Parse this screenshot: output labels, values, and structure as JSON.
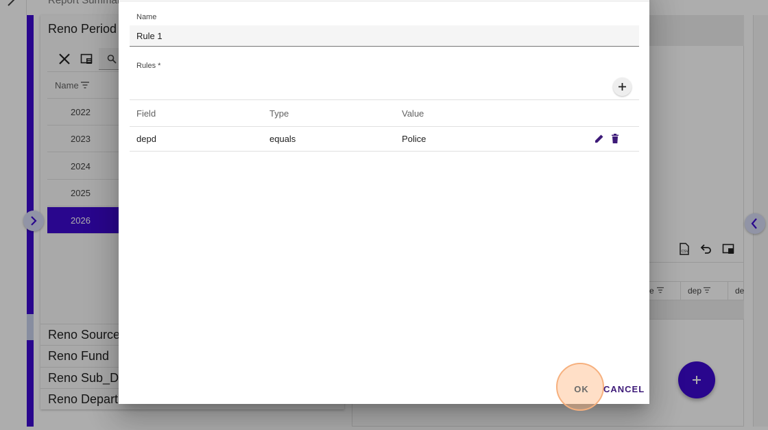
{
  "background": {
    "report_title": "Report Summary",
    "panel_title": "Reno Period",
    "name_column": "Name",
    "years": [
      "2022",
      "2023",
      "2024",
      "2025",
      "2026"
    ],
    "selected_year": "2026",
    "sections": [
      "Reno Sources",
      "Reno Fund",
      "Reno Sub_Dep",
      "Reno Departm"
    ],
    "right_table_columns": [
      "e",
      "dep",
      "de"
    ],
    "accent_color": "#3d0ad0"
  },
  "dialog": {
    "name_label": "Name",
    "name_value": "Rule 1",
    "rules_label": "Rules *",
    "columns": {
      "field": "Field",
      "type": "Type",
      "value": "Value"
    },
    "rules": [
      {
        "field": "depd",
        "type": "equals",
        "value": "Police"
      }
    ],
    "ok_label": "OK",
    "cancel_label": "CANCEL"
  }
}
